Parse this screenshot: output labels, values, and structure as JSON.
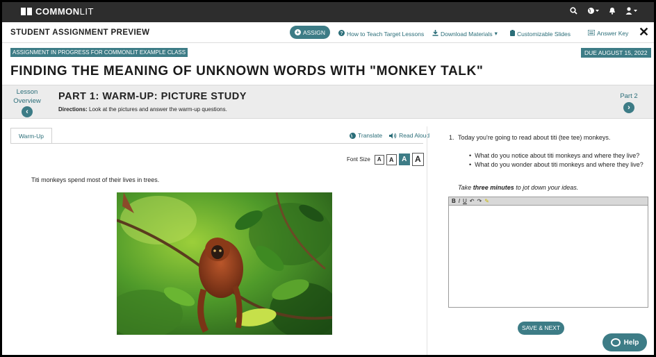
{
  "nav": {
    "brand_common": "COMMON",
    "brand_lit": "LIT",
    "icons": [
      "search-icon",
      "globe-icon",
      "bell-icon",
      "user-icon"
    ]
  },
  "preview_bar": {
    "title": "STUDENT ASSIGNMENT PREVIEW",
    "assign": "ASSIGN",
    "how_to_teach": "How to Teach Target Lessons",
    "download": "Download Materials",
    "slides": "Customizable Slides",
    "answer_key": "Answer Key",
    "close": "✕"
  },
  "header": {
    "in_progress": "ASSIGNMENT IN PROGRESS FOR COMMONLIT EXAMPLE CLASS",
    "due": "DUE AUGUST 15, 2022",
    "title": "FINDING THE MEANING OF UNKNOWN WORDS WITH \"MONKEY TALK\""
  },
  "part": {
    "overview_line1": "Lesson",
    "overview_line2": "Overview",
    "title": "PART 1: WARM-UP: PICTURE STUDY",
    "directions_label": "Directions:",
    "directions_text": "Look at the pictures and answer the warm-up questions.",
    "next_label": "Part 2"
  },
  "content": {
    "tab": "Warm-Up",
    "translate": "Translate",
    "read_aloud": "Read Aloud",
    "font_size_label": "Font Size",
    "font_sizes": [
      "A",
      "A",
      "A",
      "A"
    ],
    "selected_font_size": 3,
    "passage": "Titi monkeys spend most of their lives in trees."
  },
  "question": {
    "number": "1.",
    "text": "Today you're going to read about titi (tee tee) monkeys.",
    "bullets": [
      "What do you notice about titi monkeys and where they live?",
      "What do you wonder about titi monkeys and where they live?"
    ],
    "take_pre": "Take ",
    "take_bold": "three minutes",
    "take_post": " to jot down your ideas.",
    "editor_tools": [
      "B",
      "I",
      "U",
      "↶",
      "↷",
      "✎"
    ],
    "save_next": "SAVE & NEXT",
    "help": "Help"
  },
  "colors": {
    "accent": "#3d7c86",
    "nav_bg": "#2d2d2d",
    "link": "#2a6d78"
  }
}
